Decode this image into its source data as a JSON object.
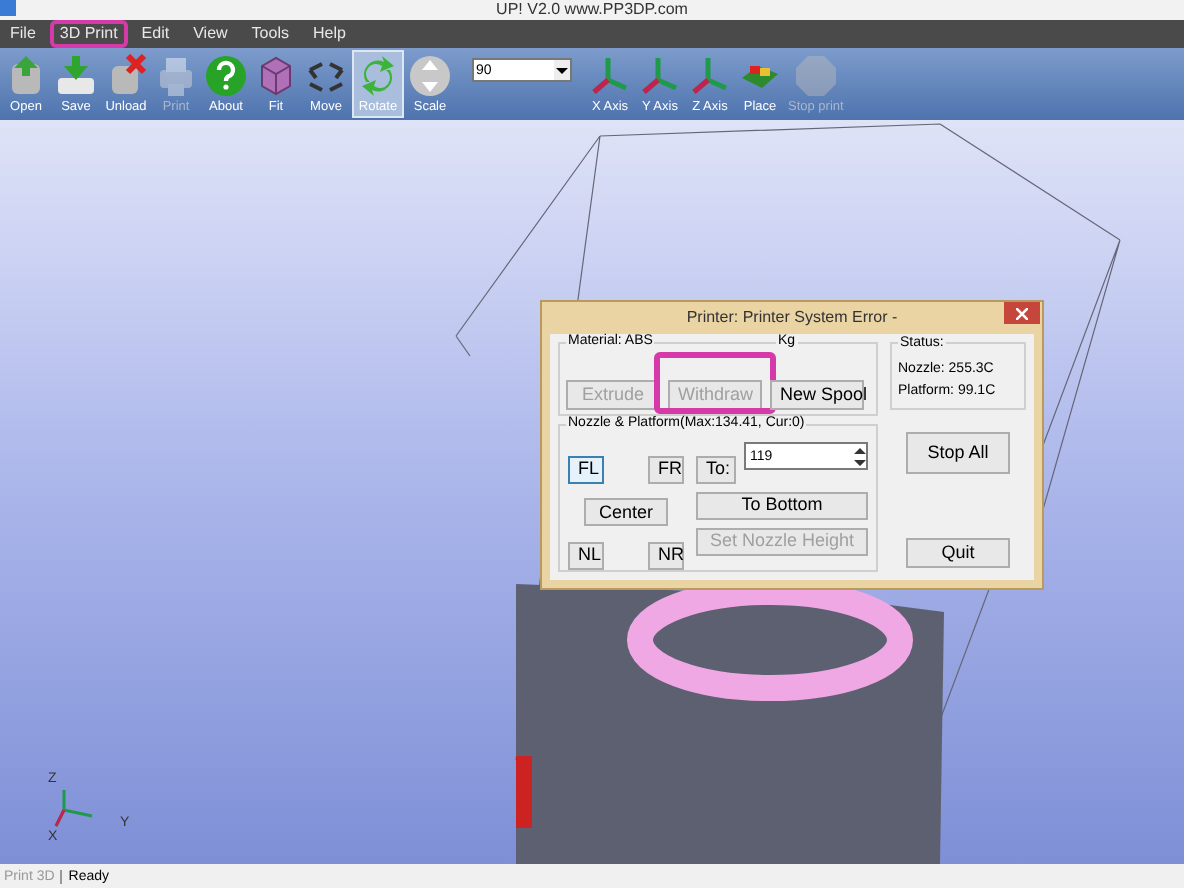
{
  "window": {
    "title": "UP!  V2.0 www.PP3DP.com"
  },
  "menu": [
    {
      "label": "File",
      "annotated": false
    },
    {
      "label": "3D Print",
      "annotated": true
    },
    {
      "label": "Edit",
      "annotated": false
    },
    {
      "label": "View",
      "annotated": false
    },
    {
      "label": "Tools",
      "annotated": false
    },
    {
      "label": "Help",
      "annotated": false
    }
  ],
  "toolbar": [
    {
      "kind": "button",
      "label": "Open",
      "disabled": false,
      "selected": false
    },
    {
      "kind": "button",
      "label": "Save",
      "disabled": false,
      "selected": false
    },
    {
      "kind": "button",
      "label": "Unload",
      "disabled": false,
      "selected": false
    },
    {
      "kind": "button",
      "label": "Print",
      "disabled": true,
      "selected": false
    },
    {
      "kind": "button",
      "label": "About",
      "disabled": false,
      "selected": false
    },
    {
      "kind": "button",
      "label": "Fit",
      "disabled": false,
      "selected": false
    },
    {
      "kind": "button",
      "label": "Move",
      "disabled": false,
      "selected": false
    },
    {
      "kind": "button",
      "label": "Rotate",
      "disabled": false,
      "selected": true
    },
    {
      "kind": "button",
      "label": "Scale",
      "disabled": false,
      "selected": false
    },
    {
      "kind": "combo",
      "value": "90"
    },
    {
      "kind": "button",
      "label": "X Axis",
      "disabled": false,
      "selected": false
    },
    {
      "kind": "button",
      "label": "Y Axis",
      "disabled": false,
      "selected": false
    },
    {
      "kind": "button",
      "label": "Z Axis",
      "disabled": false,
      "selected": false
    },
    {
      "kind": "button",
      "label": "Place",
      "disabled": false,
      "selected": false
    },
    {
      "kind": "button",
      "label": "Stop print",
      "disabled": true,
      "selected": false
    }
  ],
  "dialog": {
    "title": "Printer: Printer System Error -",
    "material": {
      "label": "Material: ABS",
      "label_end": "Kg",
      "buttons": [
        {
          "label": "Extrude",
          "disabled": true,
          "annotated": false
        },
        {
          "label": "Withdraw",
          "disabled": true,
          "annotated": true
        },
        {
          "label": "New Spool",
          "disabled": false,
          "annotated": false
        }
      ]
    },
    "status": {
      "label": "Status:",
      "nozzle": "Nozzle: 255.3C",
      "platform": "Platform: 99.1C"
    },
    "nozzle_platform": {
      "label": "Nozzle & Platform(Max:134.41, Cur:0)",
      "pad": [
        {
          "label": "FL",
          "selected": true
        },
        {
          "label": "FR",
          "selected": false
        },
        {
          "label": "Center",
          "selected": false
        },
        {
          "label": "NL",
          "selected": false
        },
        {
          "label": "NR",
          "selected": false
        }
      ],
      "to_label": "To:",
      "to_value": "119",
      "to_bottom": "To Bottom",
      "set_height": {
        "label": "Set Nozzle Height",
        "disabled": true
      }
    },
    "stop_all": "Stop All",
    "quit": "Quit"
  },
  "axes": {
    "z": "Z",
    "y": "Y",
    "x": "X"
  },
  "status_bar": {
    "mode": "Print 3D",
    "message": "Ready"
  }
}
